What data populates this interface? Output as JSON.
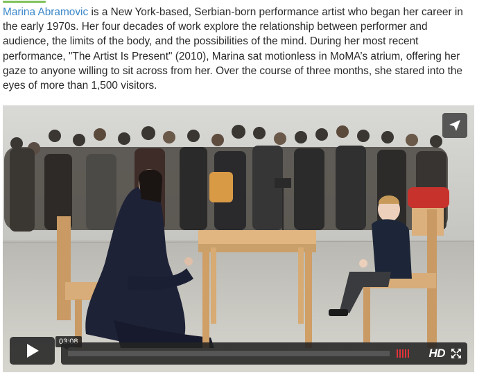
{
  "intro": {
    "link_text": "Marina Abramovic",
    "body_text": " is a New York-based, Serbian-born performance artist who began her career in the early 1970s. Her four decades of work explore the relationship between performer and audience, the limits of the body, and the possibilities of the mind. During her most recent performance, \"The Artist Is Present\" (2010), Marina sat motionless in MoMA’s atrium, offering her gaze to anyone willing to sit across from her. Over the course of three months, she stared into the eyes of more than 1,500 visitors."
  },
  "video": {
    "duration": "03:08",
    "progress": 0.0,
    "quality_label": "HD",
    "icons": {
      "share": "paper-plane-icon",
      "play": "play-icon",
      "volume": "volume-bars-icon",
      "fullscreen": "fullscreen-icon"
    },
    "colors": {
      "link": "#3a86c9",
      "accent_bar": "#7fc25a",
      "volume_bars": "#e0343a",
      "control_bg": "#232323"
    }
  }
}
